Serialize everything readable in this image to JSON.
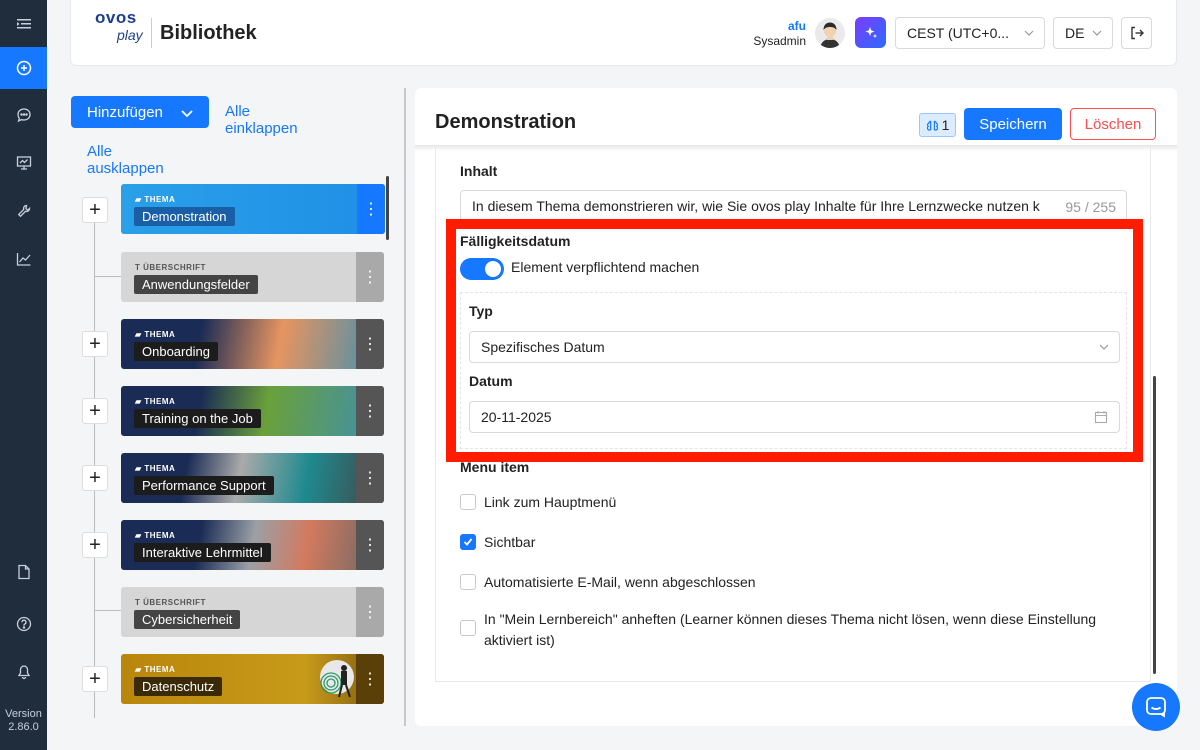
{
  "sidebar": {
    "icons": [
      "menu-icon",
      "add-circle-icon",
      "chat-icon",
      "presentation-icon",
      "tools-icon",
      "chart-icon",
      "document-icon",
      "help-icon",
      "bell-icon"
    ],
    "version_label": "Version",
    "version_number": "2.86.0"
  },
  "header": {
    "logo_top": "ovos",
    "logo_bottom": "play",
    "title": "Bibliothek",
    "user_name": "afu",
    "user_role": "Sysadmin",
    "timezone": "CEST (UTC+0...",
    "language": "DE"
  },
  "tree": {
    "add_label": "Hinzufügen",
    "collapse_all": "Alle einklappen",
    "expand_all": "Alle ausklappen",
    "nodes": [
      {
        "type": "THEMA",
        "label": "Demonstration"
      },
      {
        "type": "ÜBERSCHRIFT",
        "label": "Anwendungsfelder"
      },
      {
        "type": "THEMA",
        "label": "Onboarding"
      },
      {
        "type": "THEMA",
        "label": "Training on the Job"
      },
      {
        "type": "THEMA",
        "label": "Performance Support"
      },
      {
        "type": "THEMA",
        "label": "Interaktive Lehrmittel"
      },
      {
        "type": "ÜBERSCHRIFT",
        "label": "Cybersicherheit"
      },
      {
        "type": "THEMA",
        "label": "Datenschutz"
      }
    ]
  },
  "panel": {
    "title": "Demonstration",
    "badge_count": "1",
    "save_label": "Speichern",
    "delete_label": "Löschen",
    "content_label": "Inhalt",
    "content_value": "In diesem Thema demonstrieren wir, wie Sie ovos play Inhalte für Ihre Lernzwecke nutzen k",
    "content_counter": "95 / 255",
    "due_date_label": "Fälligkeitsdatum",
    "mandatory_label": "Element verpflichtend machen",
    "mandatory_on": true,
    "type_label": "Typ",
    "type_value": "Spezifisches Datum",
    "date_label": "Datum",
    "date_value": "20-11-2025",
    "menu_label": "Menu item",
    "options": [
      {
        "label": "Link zum Hauptmenü",
        "checked": false
      },
      {
        "label": "Sichtbar",
        "checked": true
      },
      {
        "label": "Automatisierte E-Mail, wenn abgeschlossen",
        "checked": false
      },
      {
        "label": "In \"Mein Lernbereich\" anheften (Learner können dieses Thema nicht lösen, wenn diese Einstellung aktiviert ist)",
        "checked": false
      }
    ]
  },
  "colors": {
    "accent": "#1677ff",
    "highlight": "#ff1c00",
    "sidebar": "#1f2d3d",
    "danger": "#ff4d4f"
  }
}
